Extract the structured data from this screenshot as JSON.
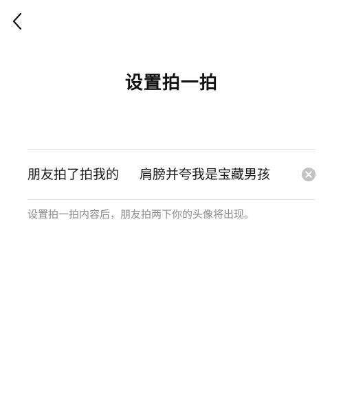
{
  "nav": {
    "back_icon": "chevron-left-icon"
  },
  "header": {
    "title": "设置拍一拍"
  },
  "pat_setting": {
    "prefix": "朋友拍了拍我的",
    "suffix_value": "肩膀并夸我是宝藏男孩",
    "clear_icon": "clear-circle-icon"
  },
  "hint": {
    "text": "设置拍一拍内容后，朋友拍两下你的头像将出现。"
  },
  "colors": {
    "background": "#ffffff",
    "text": "#111111",
    "hint": "#8a8a8a",
    "divider": "#e6e6e6",
    "clear_button": "#c2c2c2"
  }
}
